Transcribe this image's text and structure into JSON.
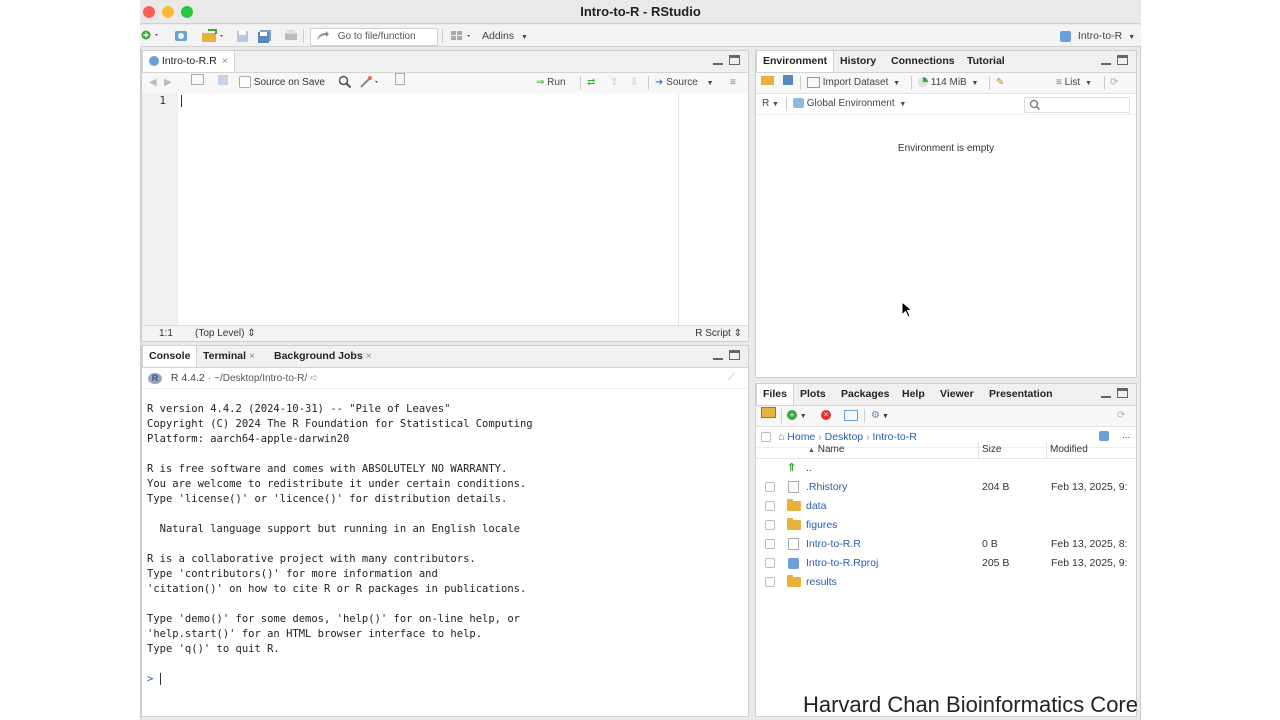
{
  "window": {
    "title": "Intro-to-R - RStudio"
  },
  "toolbar": {
    "goto_placeholder": "Go to file/function",
    "addins": "Addins",
    "project": "Intro-to-R"
  },
  "editor": {
    "tab": "Intro-to-R.R",
    "source_on_save": "Source on Save",
    "run": "Run",
    "source": "Source",
    "line_number": "1",
    "status_pos": "1:1",
    "status_level": "(Top Level)",
    "status_type": "R Script"
  },
  "console": {
    "tabs": [
      "Console",
      "Terminal",
      "Background Jobs"
    ],
    "version_label": "R 4.4.2",
    "path": "~/Desktop/Intro-to-R/",
    "lines": [
      "R version 4.4.2 (2024-10-31) -- \"Pile of Leaves\"",
      "Copyright (C) 2024 The R Foundation for Statistical Computing",
      "Platform: aarch64-apple-darwin20",
      "",
      "R is free software and comes with ABSOLUTELY NO WARRANTY.",
      "You are welcome to redistribute it under certain conditions.",
      "Type 'license()' or 'licence()' for distribution details.",
      "",
      "  Natural language support but running in an English locale",
      "",
      "R is a collaborative project with many contributors.",
      "Type 'contributors()' for more information and",
      "'citation()' on how to cite R or R packages in publications.",
      "",
      "Type 'demo()' for some demos, 'help()' for on-line help, or",
      "'help.start()' for an HTML browser interface to help.",
      "Type 'q()' to quit R."
    ],
    "prompt": ">"
  },
  "environment": {
    "tabs": [
      "Environment",
      "History",
      "Connections",
      "Tutorial"
    ],
    "import_dataset": "Import Dataset",
    "memory": "114 MiB",
    "view_mode": "List",
    "lang": "R",
    "scope": "Global Environment",
    "empty_message": "Environment is empty"
  },
  "files": {
    "tabs": [
      "Files",
      "Plots",
      "Packages",
      "Help",
      "Viewer",
      "Presentation"
    ],
    "breadcrumb": [
      "Home",
      "Desktop",
      "Intro-to-R"
    ],
    "more": "...",
    "columns": {
      "name": "Name",
      "size": "Size",
      "modified": "Modified"
    },
    "parent": "..",
    "rows": [
      {
        "name": ".Rhistory",
        "size": "204 B",
        "modified": "Feb 13, 2025, 9:",
        "kind": "file"
      },
      {
        "name": "data",
        "size": "",
        "modified": "",
        "kind": "folder"
      },
      {
        "name": "figures",
        "size": "",
        "modified": "",
        "kind": "folder"
      },
      {
        "name": "Intro-to-R.R",
        "size": "0 B",
        "modified": "Feb 13, 2025, 8:",
        "kind": "rscript"
      },
      {
        "name": "Intro-to-R.Rproj",
        "size": "205 B",
        "modified": "Feb 13, 2025, 9:",
        "kind": "rproj"
      },
      {
        "name": "results",
        "size": "",
        "modified": "",
        "kind": "folder"
      }
    ]
  },
  "watermark": "Harvard Chan Bioinformatics Core"
}
